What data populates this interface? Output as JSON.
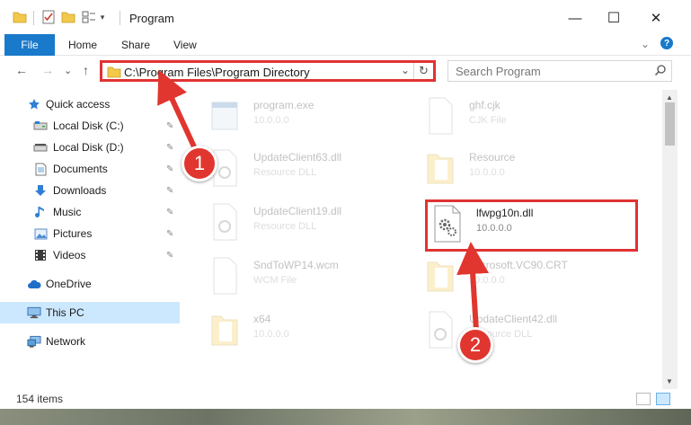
{
  "window": {
    "title": "Program",
    "minimize_glyph": "—",
    "maximize_glyph": "☐",
    "close_glyph": "✕"
  },
  "ribbon": {
    "tabs": [
      "File",
      "Home",
      "Share",
      "View"
    ],
    "expand_glyph": "⌄",
    "help_glyph": "?"
  },
  "nav": {
    "back_glyph": "←",
    "forward_glyph": "→",
    "recent_glyph": "⌄",
    "up_glyph": "↑",
    "address_path": "C:\\Program Files\\Program Directory",
    "address_dropdown_glyph": "⌄",
    "refresh_glyph": "↻",
    "search_placeholder": "Search Program"
  },
  "sidebar": {
    "items": [
      {
        "label": "Quick access",
        "icon": "star-icon",
        "pinned": false
      },
      {
        "label": "Local Disk (C:)",
        "icon": "drive-icon",
        "pinned": true
      },
      {
        "label": "Local Disk (D:)",
        "icon": "drive-icon",
        "pinned": true
      },
      {
        "label": "Documents",
        "icon": "documents-icon",
        "pinned": true
      },
      {
        "label": "Downloads",
        "icon": "download-icon",
        "pinned": true
      },
      {
        "label": "Music",
        "icon": "music-icon",
        "pinned": true
      },
      {
        "label": "Pictures",
        "icon": "pictures-icon",
        "pinned": true
      },
      {
        "label": "Videos",
        "icon": "videos-icon",
        "pinned": true
      },
      {
        "label": "OneDrive",
        "icon": "cloud-icon",
        "pinned": false
      },
      {
        "label": "This PC",
        "icon": "computer-icon",
        "pinned": false,
        "selected": true
      },
      {
        "label": "Network",
        "icon": "network-icon",
        "pinned": false
      }
    ],
    "pin_glyph": "📌"
  },
  "files": [
    {
      "name": "program.exe",
      "sub": "10.0.0.0",
      "icon": "exe-icon"
    },
    {
      "name": "ghf.cjk",
      "sub": "CJK File",
      "icon": "file-icon"
    },
    {
      "name": "UpdateClient63.dll",
      "sub": "Resource DLL",
      "icon": "dll-icon"
    },
    {
      "name": "Resource",
      "sub": "10.0.0.0",
      "icon": "folder-icon"
    },
    {
      "name": "UpdateClient19.dll",
      "sub": "Resource DLL",
      "icon": "dll-icon"
    },
    {
      "name": "lfwpg10n.dll",
      "sub": "10.0.0.0",
      "icon": "dll-gear-icon",
      "highlighted": true
    },
    {
      "name": "SndToWP14.wcm",
      "sub": "WCM File",
      "icon": "file-icon"
    },
    {
      "name": "Microsoft.VC90.CRT",
      "sub": "10.0.0.0",
      "icon": "folder-icon"
    },
    {
      "name": "x64",
      "sub": "10.0.0.0",
      "icon": "folder-icon"
    },
    {
      "name": "UpdateClient42.dll",
      "sub": "Resource DLL",
      "icon": "dll-icon"
    }
  ],
  "status": {
    "item_count": "154 items"
  },
  "annotations": {
    "step1": "1",
    "step2": "2"
  },
  "colors": {
    "accent": "#1979ca",
    "annotation_red": "#e03232",
    "selected_bg": "#cce8ff"
  }
}
